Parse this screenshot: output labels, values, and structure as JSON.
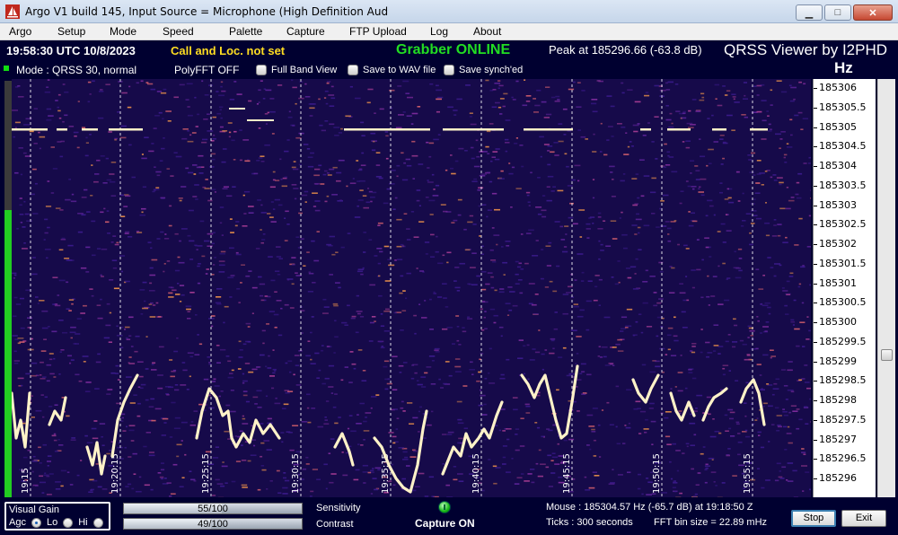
{
  "window": {
    "title": "Argo V1 build 145, Input Source = Microphone (High Definition Aud",
    "minimize_icon": "minimize-icon",
    "maximize_icon": "maximize-icon",
    "close_icon": "close-icon"
  },
  "menu": [
    "Argo",
    "Setup",
    "Mode",
    "Speed",
    "Palette",
    "Capture",
    "FTP Upload",
    "Log",
    "About"
  ],
  "info": {
    "clock": "19:58:30 UTC  10/8/2023",
    "callloc": "Call and Loc. not set",
    "grabber": "Grabber ONLINE",
    "peak": "Peak at   185296.66 (-63.8 dB)",
    "brand": "QRSS Viewer by I2PHD",
    "hz": "Hz"
  },
  "mode": {
    "label": "Mode : QRSS 30, normal",
    "poly": "PolyFFT OFF",
    "full_band": "Full Band View",
    "save_wav": "Save to WAV file",
    "save_synch": "Save synch'ed"
  },
  "freq_scale": [
    "185306",
    "185305.5",
    "185305",
    "185304.5",
    "185304",
    "185303.5",
    "185303",
    "185302.5",
    "185302",
    "185301.5",
    "185301",
    "185300.5",
    "185300",
    "185299.5",
    "185299",
    "185298.5",
    "185298",
    "185297.5",
    "185297",
    "185296.5",
    "185296"
  ],
  "time_labels": [
    "19:15",
    "19:20:15",
    "19:25:15",
    "19:30:15",
    "19:35:15",
    "19:40:15",
    "19:45:15",
    "19:50:15",
    "19:55:15"
  ],
  "bottom": {
    "visual_gain": "Visual Gain",
    "agc": "Agc",
    "lo": "Lo",
    "hi": "Hi",
    "sensitivity_value": "55/100",
    "contrast_value": "49/100",
    "sensitivity": 0.55,
    "contrast": 0.49,
    "sensitivity_label": "Sensitivity",
    "contrast_label": "Contrast",
    "capture": "Capture ON",
    "mouse": "Mouse :    185304.57 Hz  (-65.7 dB) at 19:18:50 Z",
    "ticks": "Ticks   :  300 seconds",
    "fft_bin": "FFT bin size = 22.89 mHz",
    "stop": "Stop",
    "exit": "Exit"
  },
  "colors": {
    "waterfall_bg": "#160a4a",
    "signal": "#fff2c8",
    "grabber": "#22dd22",
    "callloc": "#ffdd22"
  }
}
